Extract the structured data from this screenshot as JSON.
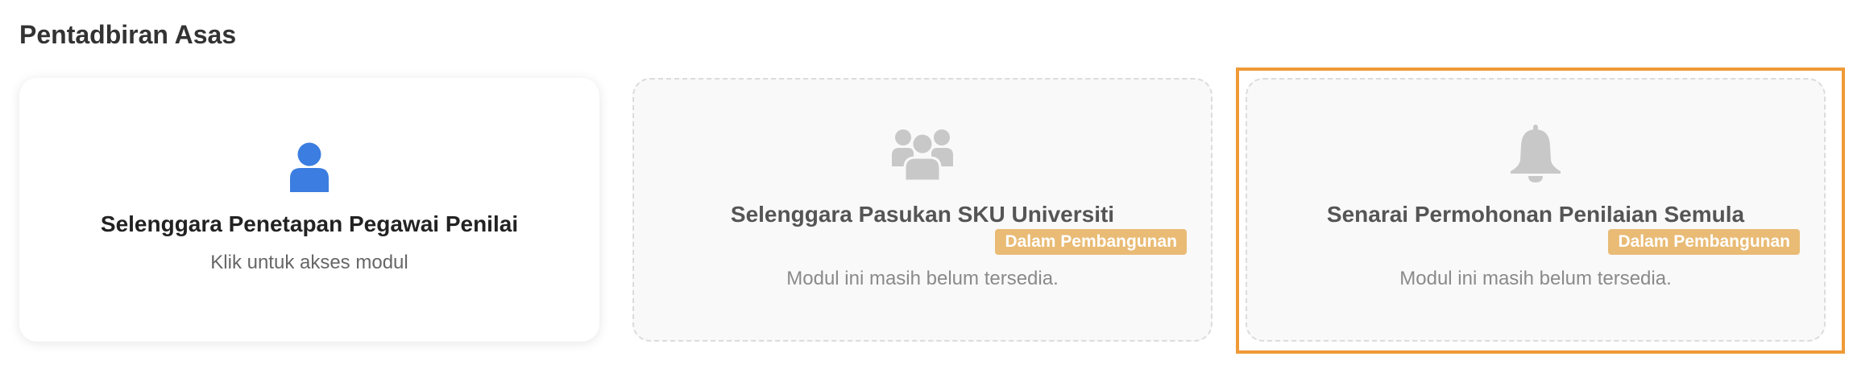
{
  "section": {
    "title": "Pentadbiran Asas"
  },
  "cards": [
    {
      "title": "Selenggara Penetapan Pegawai Penilai",
      "description": "Klik untuk akses modul",
      "icon": "user-icon",
      "status": "active",
      "icon_color": "#3b7de0"
    },
    {
      "title": "Selenggara Pasukan SKU Universiti",
      "badge": "Dalam Pembangunan",
      "description": "Modul ini masih belum tersedia.",
      "icon": "users-group-icon",
      "status": "disabled",
      "icon_color": "#c8c8c8"
    },
    {
      "title": "Senarai Permohonan Penilaian Semula",
      "badge": "Dalam Pembangunan",
      "description": "Modul ini masih belum tersedia.",
      "icon": "bell-icon",
      "status": "disabled",
      "icon_color": "#c8c8c8",
      "highlighted": true
    }
  ],
  "colors": {
    "badge": "#e9bb75",
    "highlight_border": "#ef9a37",
    "active_icon": "#3b7de0",
    "disabled_icon": "#c8c8c8"
  }
}
